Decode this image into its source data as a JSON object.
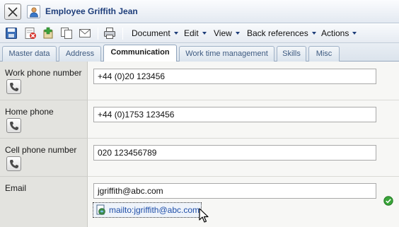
{
  "window": {
    "title": "Employee Griffith Jean"
  },
  "toolbar": {
    "icons": [
      "save-icon",
      "delete-icon",
      "new-record-icon",
      "copy-icon",
      "email-icon",
      "print-icon"
    ],
    "menus": [
      {
        "label": "Document"
      },
      {
        "label": "Edit"
      },
      {
        "label": "View"
      },
      {
        "label": "Back references"
      },
      {
        "label": "Actions"
      }
    ]
  },
  "tabs": [
    {
      "label": "Master data",
      "active": false
    },
    {
      "label": "Address",
      "active": false
    },
    {
      "label": "Communication",
      "active": true
    },
    {
      "label": "Work time management",
      "active": false
    },
    {
      "label": "Skills",
      "active": false
    },
    {
      "label": "Misc",
      "active": false
    }
  ],
  "fields": {
    "work_phone": {
      "label": "Work phone number",
      "value": "+44 (0)20 123456"
    },
    "home_phone": {
      "label": "Home phone",
      "value": "+44 (0)1753 123456"
    },
    "cell_phone": {
      "label": "Cell phone number",
      "value": "020 123456789"
    },
    "email": {
      "label": "Email",
      "value": "jgriffith@abc.com",
      "link": "mailto:jgriffith@abc.com",
      "status": "valid"
    }
  },
  "colors": {
    "title": "#1d3d7a",
    "link": "#1e4ea8",
    "label_bg": "#e3e3df",
    "ok": "#3aa53a"
  }
}
